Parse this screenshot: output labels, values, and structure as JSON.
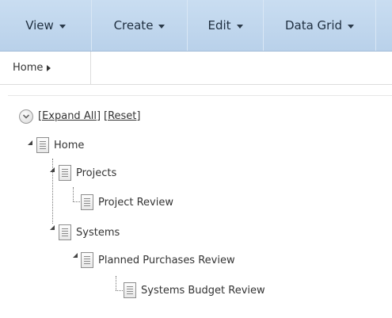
{
  "toolbar": {
    "menus": [
      {
        "label": "View"
      },
      {
        "label": "Create"
      },
      {
        "label": "Edit"
      },
      {
        "label": "Data Grid"
      }
    ]
  },
  "breadcrumb": {
    "items": [
      {
        "label": "Home"
      }
    ]
  },
  "tree_controls": {
    "expand_all": "[Expand All]",
    "reset": "[Reset]"
  },
  "tree": {
    "home": "Home",
    "projects": "Projects",
    "project_review": "Project Review",
    "systems": "Systems",
    "planned_purchases_review": "Planned Purchases Review",
    "systems_budget_review": "Systems Budget Review"
  }
}
